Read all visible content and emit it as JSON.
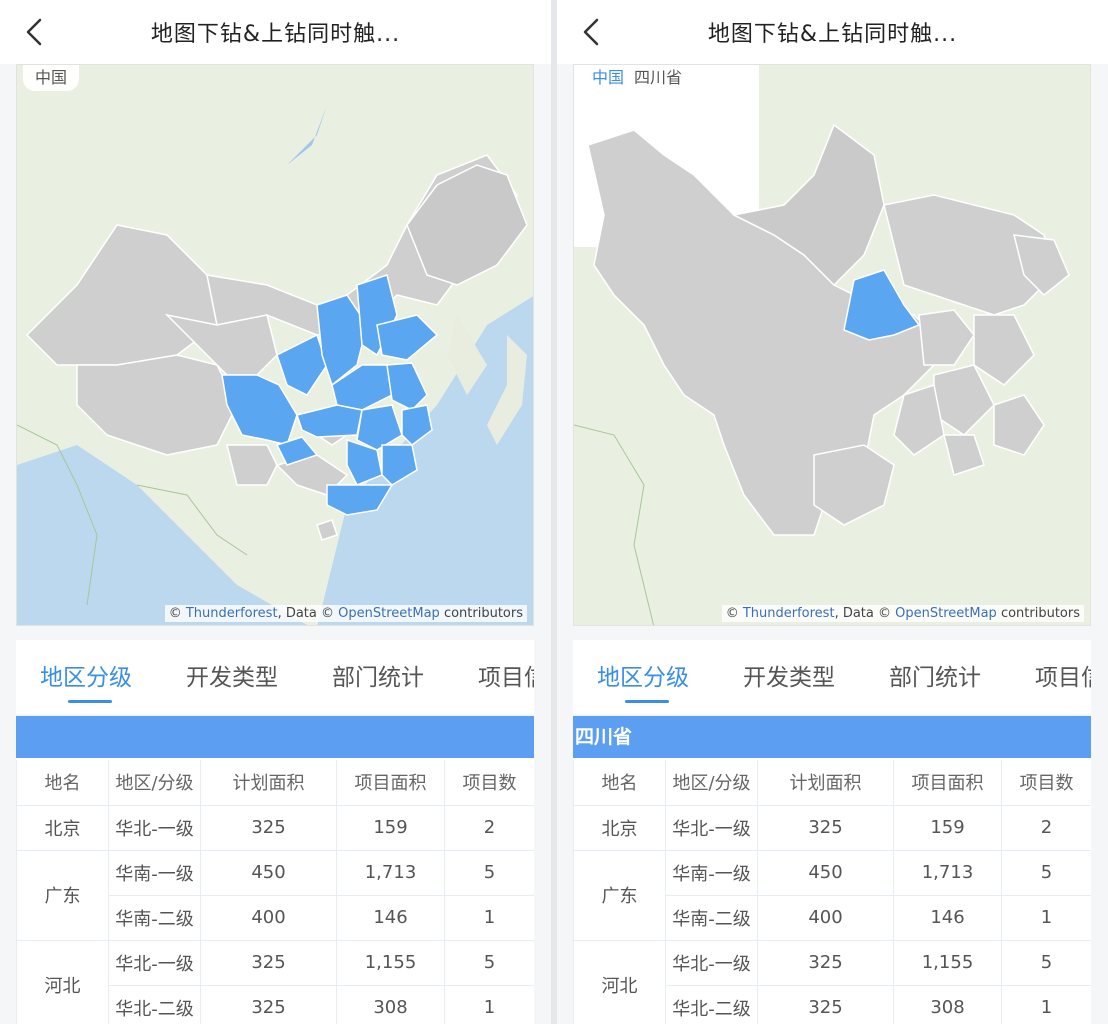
{
  "left": {
    "title": "地图下钻&上钻同时触...",
    "breadcrumb": [
      "中国"
    ],
    "attribution": {
      "prefix": "© ",
      "source": "Thunderforest",
      "mid": ", Data © ",
      "osm": "OpenStreetMap",
      "suffix": " contributors"
    },
    "tabs": [
      "地区分级",
      "开发类型",
      "部门统计",
      "项目信"
    ],
    "group_label": "",
    "table": {
      "headers": [
        "地名",
        "地区/分级",
        "计划面积",
        "项目面积",
        "项目数"
      ],
      "rows": [
        [
          "北京",
          "华北-一级",
          "325",
          "159",
          "2"
        ],
        [
          "广东",
          "华南-一级",
          "450",
          "1,713",
          "5"
        ],
        [
          "",
          "华南-二级",
          "400",
          "146",
          "1"
        ],
        [
          "河北",
          "华北-一级",
          "325",
          "1,155",
          "5"
        ],
        [
          "",
          "华北-二级",
          "325",
          "308",
          "1"
        ]
      ]
    }
  },
  "right": {
    "title": "地图下钻&上钻同时触...",
    "breadcrumb": [
      "中国",
      "四川省"
    ],
    "attribution": {
      "prefix": "© ",
      "source": "Thunderforest",
      "mid": ", Data © ",
      "osm": "OpenStreetMap",
      "suffix": " contributors"
    },
    "tabs": [
      "地区分级",
      "开发类型",
      "部门统计",
      "项目信"
    ],
    "group_label": "四川省",
    "table": {
      "headers": [
        "地名",
        "地区/分级",
        "计划面积",
        "项目面积",
        "项目数"
      ],
      "rows": [
        [
          "北京",
          "华北-一级",
          "325",
          "159",
          "2"
        ],
        [
          "广东",
          "华南-一级",
          "450",
          "1,713",
          "5"
        ],
        [
          "",
          "华南-二级",
          "400",
          "146",
          "1"
        ],
        [
          "河北",
          "华北-一级",
          "325",
          "1,155",
          "5"
        ],
        [
          "",
          "华北-二级",
          "325",
          "308",
          "1"
        ]
      ]
    }
  },
  "colors": {
    "accent": "#3a8ee6",
    "highlight_region": "#5aa6f0",
    "grey_region": "#cfcfcf",
    "group_bar": "#5b9ef2"
  },
  "icons": {
    "back": "chevron-left-icon"
  }
}
